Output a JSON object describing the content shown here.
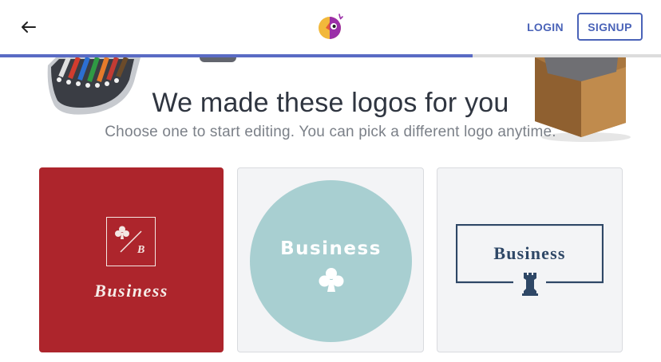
{
  "header": {
    "back_icon": "arrow-left-icon",
    "logo_icon": "brand-face-icon",
    "login_label": "LOGIN",
    "signup_label": "SIGNUP",
    "accent_color": "#4a63b8"
  },
  "progress": {
    "fraction": 0.715,
    "color": "#5a6bc4"
  },
  "main": {
    "headline": "We made these logos for you",
    "subline": "Choose one to start editing. You can pick a different logo anytime."
  },
  "logos": [
    {
      "name": "Business",
      "monogram": "B",
      "icon": "club-suit-icon",
      "background": "#ad252c"
    },
    {
      "name": "Business",
      "icon": "club-suit-icon",
      "background": "#a8cfd1"
    },
    {
      "name": "Business",
      "icon": "chess-rook-icon",
      "background": "#f3f4f6"
    }
  ]
}
